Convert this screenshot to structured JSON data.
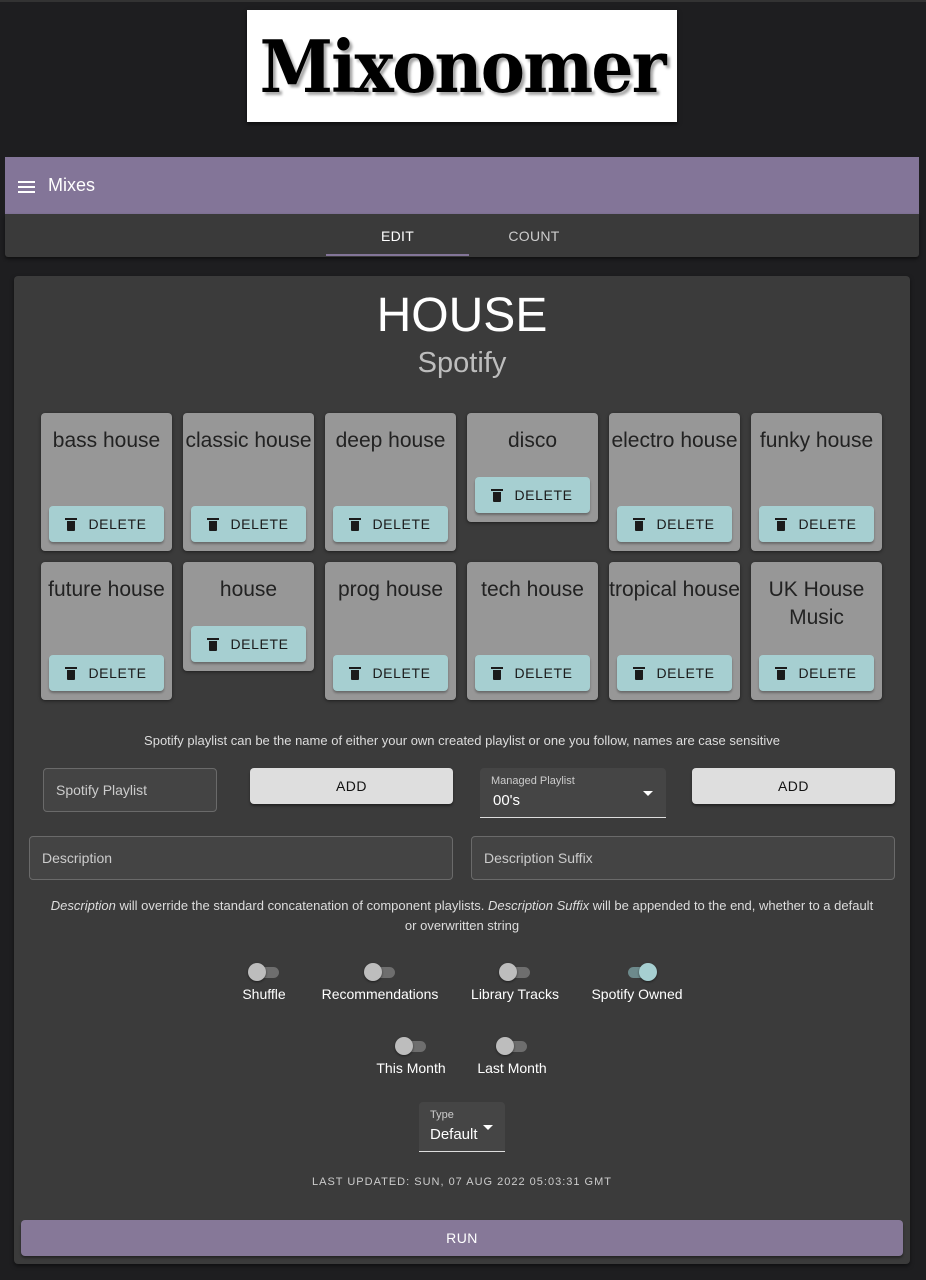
{
  "logo": {
    "text": "Mixonomer"
  },
  "appbar": {
    "title": "Mixes",
    "menu_icon": "hamburger-menu-icon"
  },
  "tabs": [
    {
      "label": "EDIT",
      "active": true
    },
    {
      "label": "COUNT",
      "active": false
    }
  ],
  "playlist": {
    "name": "HOUSE",
    "source": "Spotify"
  },
  "parts": [
    {
      "name": "bass house",
      "delete_label": "DELETE"
    },
    {
      "name": "classic house",
      "delete_label": "DELETE"
    },
    {
      "name": "deep house",
      "delete_label": "DELETE"
    },
    {
      "name": "disco",
      "delete_label": "DELETE"
    },
    {
      "name": "electro house",
      "delete_label": "DELETE"
    },
    {
      "name": "funky house",
      "delete_label": "DELETE"
    },
    {
      "name": "future house",
      "delete_label": "DELETE"
    },
    {
      "name": "house",
      "delete_label": "DELETE"
    },
    {
      "name": "prog house",
      "delete_label": "DELETE"
    },
    {
      "name": "tech house",
      "delete_label": "DELETE"
    },
    {
      "name": "tropical house",
      "delete_label": "DELETE"
    },
    {
      "name": "UK House Music",
      "delete_label": "DELETE"
    }
  ],
  "hint": "Spotify playlist can be the name of either your own created playlist or one you follow, names are case sensitive",
  "spotify_playlist": {
    "placeholder": "Spotify Playlist",
    "value": ""
  },
  "add_spotify_label": "ADD",
  "managed_playlist": {
    "label": "Managed Playlist",
    "value": "00's"
  },
  "add_managed_label": "ADD",
  "description": {
    "placeholder": "Description",
    "value": ""
  },
  "description_suffix": {
    "placeholder": "Description Suffix",
    "value": ""
  },
  "description_note": {
    "em1": "Description",
    "text1": " will override the standard concatenation of component playlists. ",
    "em2": "Description Suffix",
    "text2": " will be appended to the end, whether to a default or overwritten string"
  },
  "switches": [
    {
      "label": "Shuffle",
      "on": false
    },
    {
      "label": "Recommendations",
      "on": false
    },
    {
      "label": "Library Tracks",
      "on": false
    },
    {
      "label": "Spotify Owned",
      "on": true
    },
    {
      "label": "This Month",
      "on": false
    },
    {
      "label": "Last Month",
      "on": false
    }
  ],
  "type_select": {
    "label": "Type",
    "value": "Default"
  },
  "last_updated": "LAST UPDATED: SUN, 07 AUG 2022 05:03:31 GMT",
  "run_label": "RUN",
  "colors": {
    "accent": "#837598",
    "chip": "#979797",
    "delete": "#a6cfd1",
    "card": "#3b3b3b",
    "background": "#1e1e20"
  }
}
